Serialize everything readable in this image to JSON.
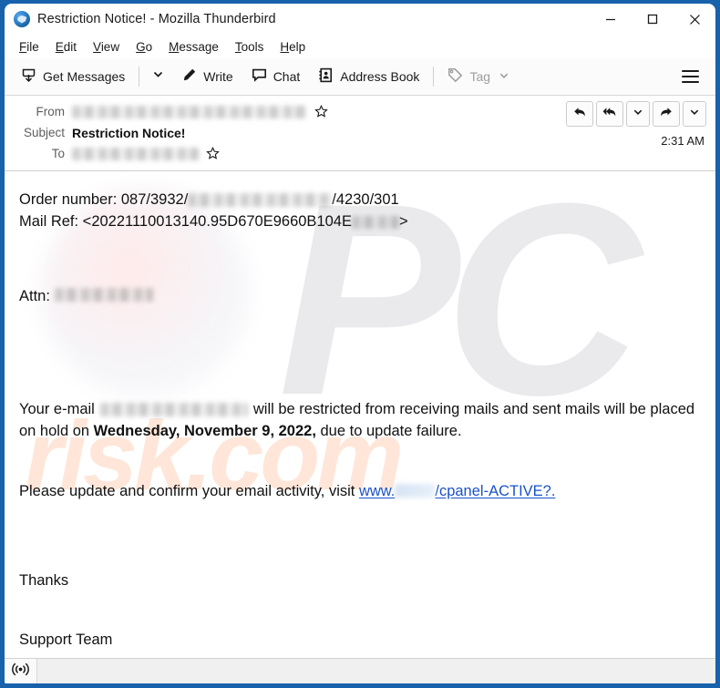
{
  "window": {
    "title": "Restriction Notice! - Mozilla Thunderbird",
    "app_icon": "thunderbird-logo-icon",
    "controls": {
      "minimize": "minimize-icon",
      "maximize": "maximize-icon",
      "close": "close-icon"
    }
  },
  "menubar": {
    "items": [
      {
        "label": "File",
        "accesskey": "F"
      },
      {
        "label": "Edit",
        "accesskey": "E"
      },
      {
        "label": "View",
        "accesskey": "V"
      },
      {
        "label": "Go",
        "accesskey": "G"
      },
      {
        "label": "Message",
        "accesskey": "M"
      },
      {
        "label": "Tools",
        "accesskey": "T"
      },
      {
        "label": "Help",
        "accesskey": "H"
      }
    ]
  },
  "toolbar": {
    "get_messages": "Get Messages",
    "get_messages_icon": "download-inbox-icon",
    "get_messages_caret": "chevron-down-icon",
    "write": "Write",
    "write_icon": "pencil-icon",
    "chat": "Chat",
    "chat_icon": "speech-bubble-icon",
    "address_book": "Address Book",
    "address_book_icon": "address-book-icon",
    "tag": "Tag",
    "tag_icon": "tag-icon",
    "tag_caret": "chevron-down-icon",
    "app_menu_icon": "hamburger-menu-icon"
  },
  "message_header": {
    "from_label": "From",
    "from_value": "",
    "from_redacted": true,
    "subject_label": "Subject",
    "subject_value": "Restriction Notice!",
    "to_label": "To",
    "to_value": "",
    "to_redacted": true,
    "star_icon": "star-outline-icon",
    "timestamp": "2:31 AM",
    "actions": [
      {
        "name": "reply-button",
        "icon": "reply-arrow-icon"
      },
      {
        "name": "reply-all-button",
        "icon": "reply-all-arrow-icon"
      },
      {
        "name": "reply-more-button",
        "icon": "chevron-down-icon"
      },
      {
        "name": "forward-button",
        "icon": "forward-arrow-icon"
      },
      {
        "name": "more-actions-button",
        "icon": "chevron-down-icon"
      }
    ]
  },
  "body": {
    "order_line_prefix": "Order number: 087/3932/",
    "order_line_suffix": "/4230/301",
    "mail_ref_prefix": "Mail Ref: <20221110013140.95D670E9660B104E",
    "mail_ref_suffix": ">",
    "attn_label": "Attn:",
    "attn_value": "",
    "para1_a": "Your e-mail",
    "para1_b": "will be restricted from receiving mails  and sent mails will be placed on hold on ",
    "para1_bold": "Wednesday, November 9, 2022,",
    "para1_c": " due to update failure.",
    "para2_a": "Please update and confirm your email activity, visit ",
    "link_prefix": "www.",
    "link_suffix": "/cpanel-ACTIVE?.",
    "signoff_thanks": "Thanks",
    "signoff_team": "Support Team"
  },
  "watermark": {
    "logo_text": "PC",
    "site_text": "risk.com"
  },
  "statusbar": {
    "connection_icon": "broadcast-online-icon",
    "text": ""
  },
  "colors": {
    "window_frame": "#1862ab",
    "link": "#1a52c8",
    "toolbar_bg": "#fbfbfb",
    "status_bg": "#f0f0f0",
    "watermark_orange": "#ffd6c0"
  }
}
